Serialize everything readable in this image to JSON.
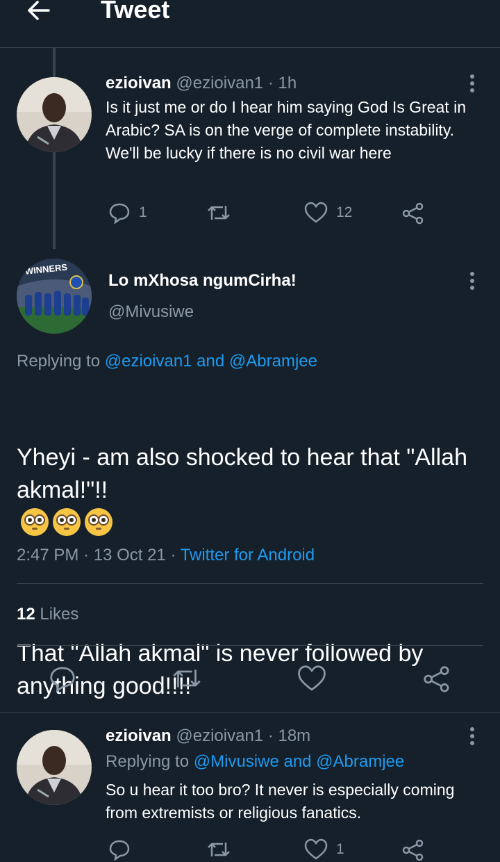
{
  "header": {
    "title": "Tweet"
  },
  "parent_tweet": {
    "display_name": "ezioivan",
    "handle": "@ezioivan1",
    "time": "· 1h",
    "text": "Is it just me or do I hear him saying God Is Great in Arabic? SA is on the verge of complete instability. We'll be lucky if there is no civil war here",
    "reply_count": "1",
    "like_count": "12"
  },
  "main_tweet": {
    "display_name": "Lo mXhosa ngumCirha!",
    "handle": "@Mivusiwe",
    "avatar_text": "WINNERS",
    "replying_prefix": "Replying to",
    "replying_to": "@ezioivan1 and @Abramjee",
    "text_line1": "Yheyi - am also shocked to hear that \"Allah akmal!\"!!",
    "text_line2": "That \"Allah akmal\" is never followed by anything good!!!!",
    "time": "2:47 PM · 13 Oct 21 · ",
    "source": "Twitter for Android",
    "likes_count": "12",
    "likes_label": "Likes"
  },
  "reply_tweet": {
    "display_name": "ezioivan",
    "handle": "@ezioivan1",
    "time": "· 18m",
    "replying_prefix": "Replying to",
    "replying_to": "@Mivusiwe and @Abramjee",
    "text": "So u hear it too bro? It never is especially coming from extremists or religious fanatics.",
    "like_count": "1"
  },
  "icons": [
    "back-arrow-icon",
    "more-icon",
    "reply-icon",
    "retweet-icon",
    "like-icon",
    "share-icon",
    "flushed-face-emoji"
  ],
  "colors": {
    "background": "#15202b",
    "accent": "#1d9bf0",
    "muted": "#8b98a5",
    "divider": "#38444d"
  }
}
